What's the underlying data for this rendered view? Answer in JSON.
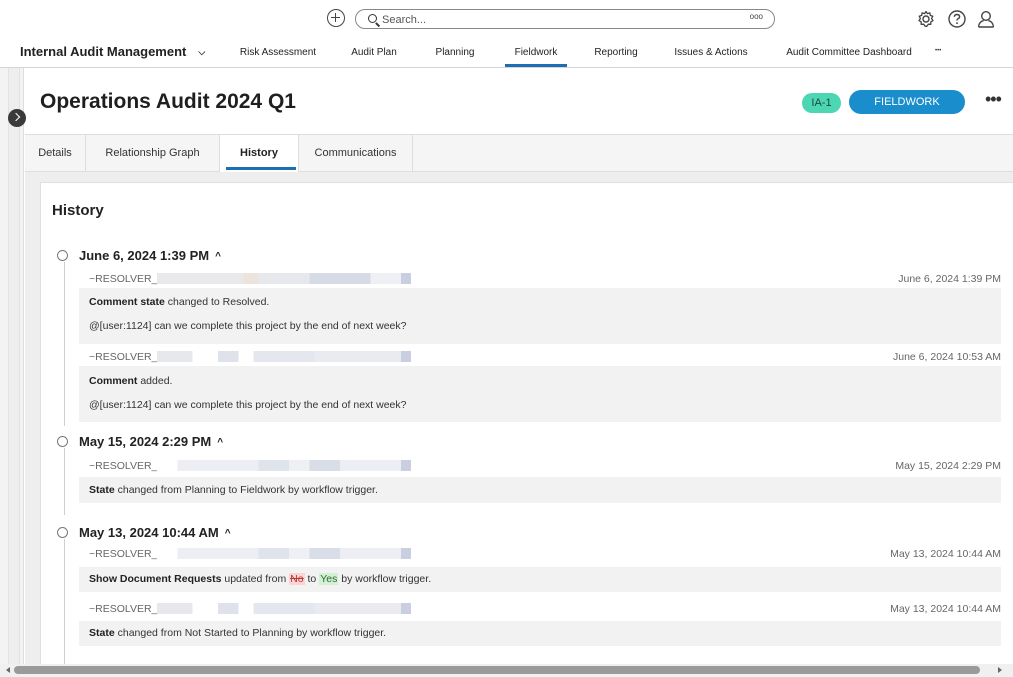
{
  "topbar": {
    "search_placeholder": "Search...",
    "search_more": "ooo"
  },
  "nav": {
    "app_name": "Internal Audit Management",
    "app_chevron": "⌄",
    "items": [
      {
        "label": "Risk Assessment"
      },
      {
        "label": "Audit Plan"
      },
      {
        "label": "Planning"
      },
      {
        "label": "Fieldwork",
        "active": true
      },
      {
        "label": "Reporting"
      },
      {
        "label": "Issues & Actions"
      },
      {
        "label": "Audit Committee Dashboard"
      }
    ],
    "more": "•••"
  },
  "header": {
    "title": "Operations Audit 2024 Q1",
    "id_badge": "IA-1",
    "state": "FIELDWORK",
    "more": "•••"
  },
  "tabs": [
    {
      "label": "Details"
    },
    {
      "label": "Relationship Graph"
    },
    {
      "label": "History",
      "active": true
    },
    {
      "label": "Communications"
    }
  ],
  "history": {
    "title": "History",
    "groups": [
      {
        "date": "June 6, 2024 1:39 PM",
        "caret": "^",
        "entries": [
          {
            "user": "~RESOLVER_",
            "time": "June 6, 2024 1:39 PM",
            "lines": [
              {
                "bold": "Comment state",
                "text": " changed to Resolved."
              },
              {
                "bold": "",
                "text": "@[user:1124] can we complete this project by the end of next week?"
              }
            ]
          },
          {
            "user": "~RESOLVER_",
            "time": "June 6, 2024 10:53 AM",
            "lines": [
              {
                "bold": "Comment",
                "text": " added."
              },
              {
                "bold": "",
                "text": "@[user:1124] can we complete this project by the end of next week?"
              }
            ]
          }
        ]
      },
      {
        "date": "May 15, 2024 2:29 PM",
        "caret": "^",
        "entries": [
          {
            "user": "~RESOLVER_",
            "time": "May 15, 2024 2:29 PM",
            "lines": [
              {
                "bold": "State",
                "text": " changed from Planning to Fieldwork by workflow trigger."
              }
            ]
          }
        ]
      },
      {
        "date": "May 13, 2024 10:44 AM",
        "caret": "^",
        "entries": [
          {
            "user": "~RESOLVER_",
            "time": "May 13, 2024 10:44 AM",
            "lines": [
              {
                "bold": "Show Document Requests",
                "pre": " updated from ",
                "old": "No",
                "mid": " to ",
                "new": "Yes",
                "post": " by workflow trigger."
              }
            ]
          },
          {
            "user": "~RESOLVER_",
            "time": "May 13, 2024 10:44 AM",
            "lines": [
              {
                "bold": "State",
                "text": " changed from Not Started to Planning by workflow trigger."
              }
            ]
          }
        ]
      }
    ]
  },
  "colors": {
    "accent": "#1d6fb3",
    "state_pill": "#1a8ecc",
    "id_badge": "#4dd6b3"
  }
}
